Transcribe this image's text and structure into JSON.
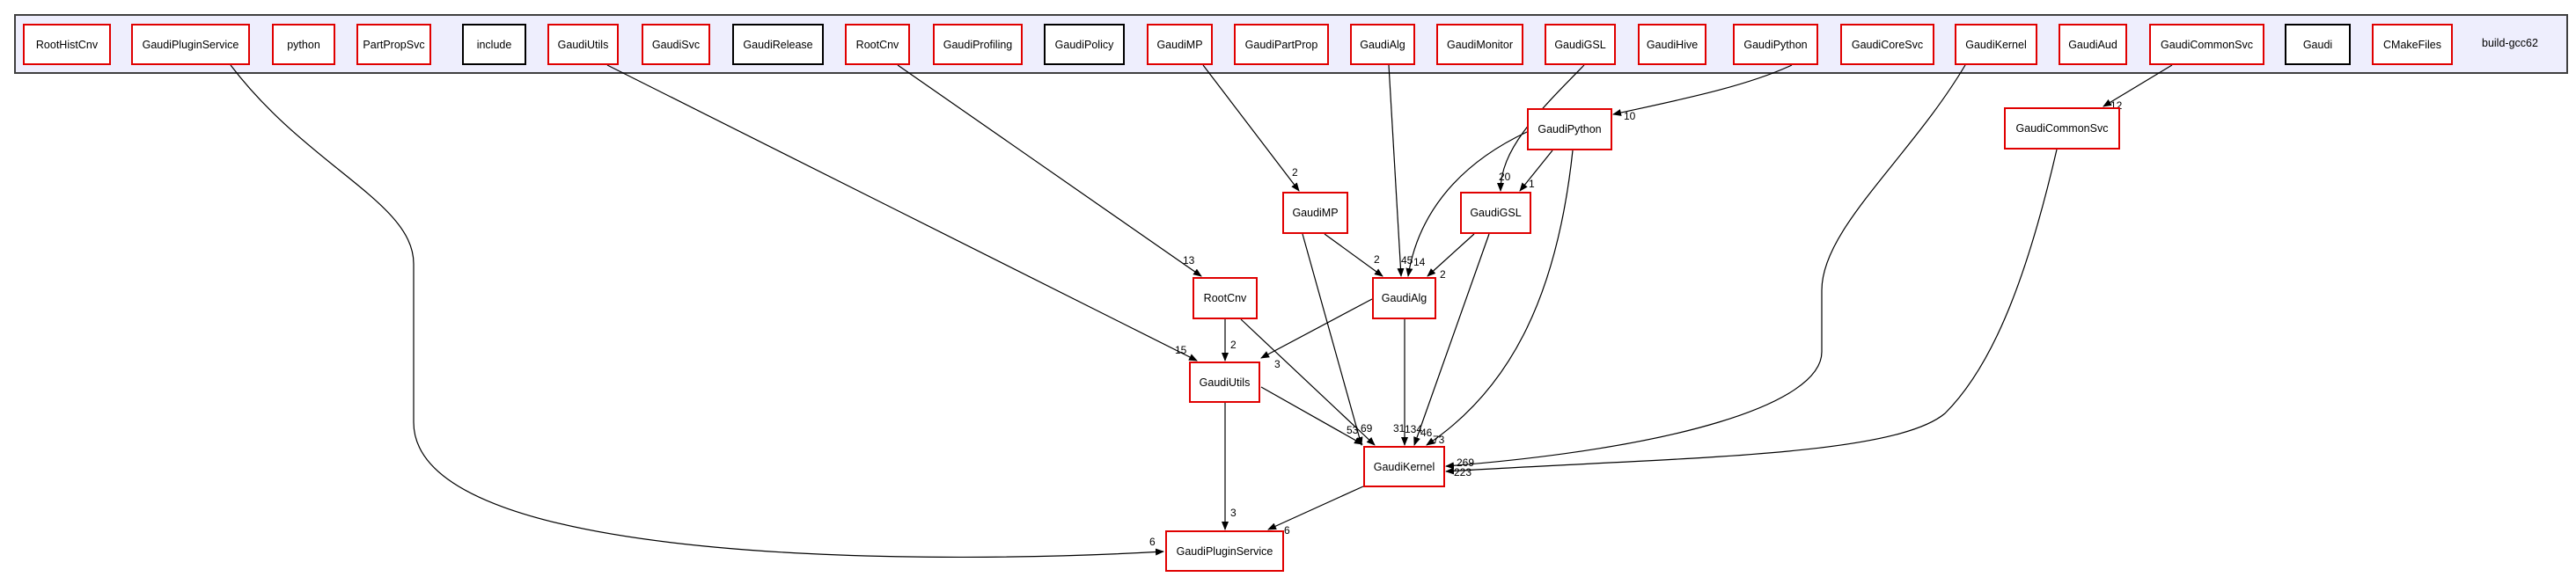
{
  "cluster": {
    "label": "build-gcc62",
    "children": [
      {
        "id": "t_RootHistCnv",
        "label": "RootHistCnv",
        "style": "red"
      },
      {
        "id": "t_GaudiPluginService",
        "label": "GaudiPluginService",
        "style": "red"
      },
      {
        "id": "t_python",
        "label": "python",
        "style": "red"
      },
      {
        "id": "t_PartPropSvc",
        "label": "PartPropSvc",
        "style": "red"
      },
      {
        "id": "t_include",
        "label": "include",
        "style": "black"
      },
      {
        "id": "t_GaudiUtils",
        "label": "GaudiUtils",
        "style": "red"
      },
      {
        "id": "t_GaudiSvc",
        "label": "GaudiSvc",
        "style": "red"
      },
      {
        "id": "t_GaudiRelease",
        "label": "GaudiRelease",
        "style": "black"
      },
      {
        "id": "t_RootCnv",
        "label": "RootCnv",
        "style": "red"
      },
      {
        "id": "t_GaudiProfiling",
        "label": "GaudiProfiling",
        "style": "red"
      },
      {
        "id": "t_GaudiPolicy",
        "label": "GaudiPolicy",
        "style": "black"
      },
      {
        "id": "t_GaudiMP",
        "label": "GaudiMP",
        "style": "red"
      },
      {
        "id": "t_GaudiPartProp",
        "label": "GaudiPartProp",
        "style": "red"
      },
      {
        "id": "t_GaudiAlg",
        "label": "GaudiAlg",
        "style": "red"
      },
      {
        "id": "t_GaudiMonitor",
        "label": "GaudiMonitor",
        "style": "red"
      },
      {
        "id": "t_GaudiGSL",
        "label": "GaudiGSL",
        "style": "red"
      },
      {
        "id": "t_GaudiHive",
        "label": "GaudiHive",
        "style": "red"
      },
      {
        "id": "t_GaudiPython",
        "label": "GaudiPython",
        "style": "red"
      },
      {
        "id": "t_GaudiCoreSvc",
        "label": "GaudiCoreSvc",
        "style": "red"
      },
      {
        "id": "t_GaudiKernel",
        "label": "GaudiKernel",
        "style": "red"
      },
      {
        "id": "t_GaudiAud",
        "label": "GaudiAud",
        "style": "red"
      },
      {
        "id": "t_GaudiCommonSvc",
        "label": "GaudiCommonSvc",
        "style": "red"
      },
      {
        "id": "t_Gaudi",
        "label": "Gaudi",
        "style": "black"
      },
      {
        "id": "t_CMakeFiles",
        "label": "CMakeFiles",
        "style": "red"
      }
    ]
  },
  "nodes": [
    {
      "id": "GaudiPython",
      "label": "GaudiPython"
    },
    {
      "id": "GaudiCommonSvc",
      "label": "GaudiCommonSvc"
    },
    {
      "id": "GaudiMP",
      "label": "GaudiMP"
    },
    {
      "id": "GaudiGSL",
      "label": "GaudiGSL"
    },
    {
      "id": "RootCnv",
      "label": "RootCnv"
    },
    {
      "id": "GaudiAlg",
      "label": "GaudiAlg"
    },
    {
      "id": "GaudiUtils",
      "label": "GaudiUtils"
    },
    {
      "id": "GaudiKernel",
      "label": "GaudiKernel"
    },
    {
      "id": "GaudiPluginService",
      "label": "GaudiPluginService"
    }
  ],
  "edges": [
    {
      "from": "t_GaudiPluginService",
      "to": "GaudiPluginService",
      "label": "6"
    },
    {
      "from": "t_GaudiUtils",
      "to": "GaudiUtils",
      "label": "15"
    },
    {
      "from": "t_RootCnv",
      "to": "RootCnv",
      "label": "13"
    },
    {
      "from": "t_GaudiMP",
      "to": "GaudiMP",
      "label": "2"
    },
    {
      "from": "t_GaudiAlg",
      "to": "GaudiAlg",
      "label": "45"
    },
    {
      "from": "t_GaudiGSL",
      "to": "GaudiGSL",
      "label": "20"
    },
    {
      "from": "t_GaudiPython",
      "to": "GaudiPython",
      "label": "10"
    },
    {
      "from": "t_GaudiKernel",
      "to": "GaudiKernel",
      "label": "269"
    },
    {
      "from": "t_GaudiCommonSvc",
      "to": "GaudiCommonSvc",
      "label": "12"
    },
    {
      "from": "GaudiPython",
      "to": "GaudiGSL",
      "label": "1"
    },
    {
      "from": "GaudiPython",
      "to": "GaudiAlg",
      "label": "14"
    },
    {
      "from": "GaudiPython",
      "to": "GaudiKernel",
      "label": "73"
    },
    {
      "from": "GaudiMP",
      "to": "GaudiAlg",
      "label": "2"
    },
    {
      "from": "GaudiMP",
      "to": "GaudiKernel",
      "label": "31"
    },
    {
      "from": "GaudiGSL",
      "to": "GaudiAlg",
      "label": "2"
    },
    {
      "from": "GaudiGSL",
      "to": "GaudiKernel",
      "label": "46"
    },
    {
      "from": "RootCnv",
      "to": "GaudiUtils",
      "label": "2"
    },
    {
      "from": "RootCnv",
      "to": "GaudiKernel",
      "label": "69"
    },
    {
      "from": "GaudiAlg",
      "to": "GaudiUtils",
      "label": "3"
    },
    {
      "from": "GaudiAlg",
      "to": "GaudiKernel",
      "label": "134"
    },
    {
      "from": "GaudiUtils",
      "to": "GaudiKernel",
      "label": "53"
    },
    {
      "from": "GaudiUtils",
      "to": "GaudiPluginService",
      "label": "3"
    },
    {
      "from": "GaudiKernel",
      "to": "GaudiPluginService",
      "label": "6"
    },
    {
      "from": "GaudiCommonSvc",
      "to": "GaudiKernel",
      "label": "223"
    }
  ],
  "colors": {
    "cluster_fill": "#eeeefd",
    "node_border_red": "#e00000",
    "node_border_black": "#000000"
  }
}
